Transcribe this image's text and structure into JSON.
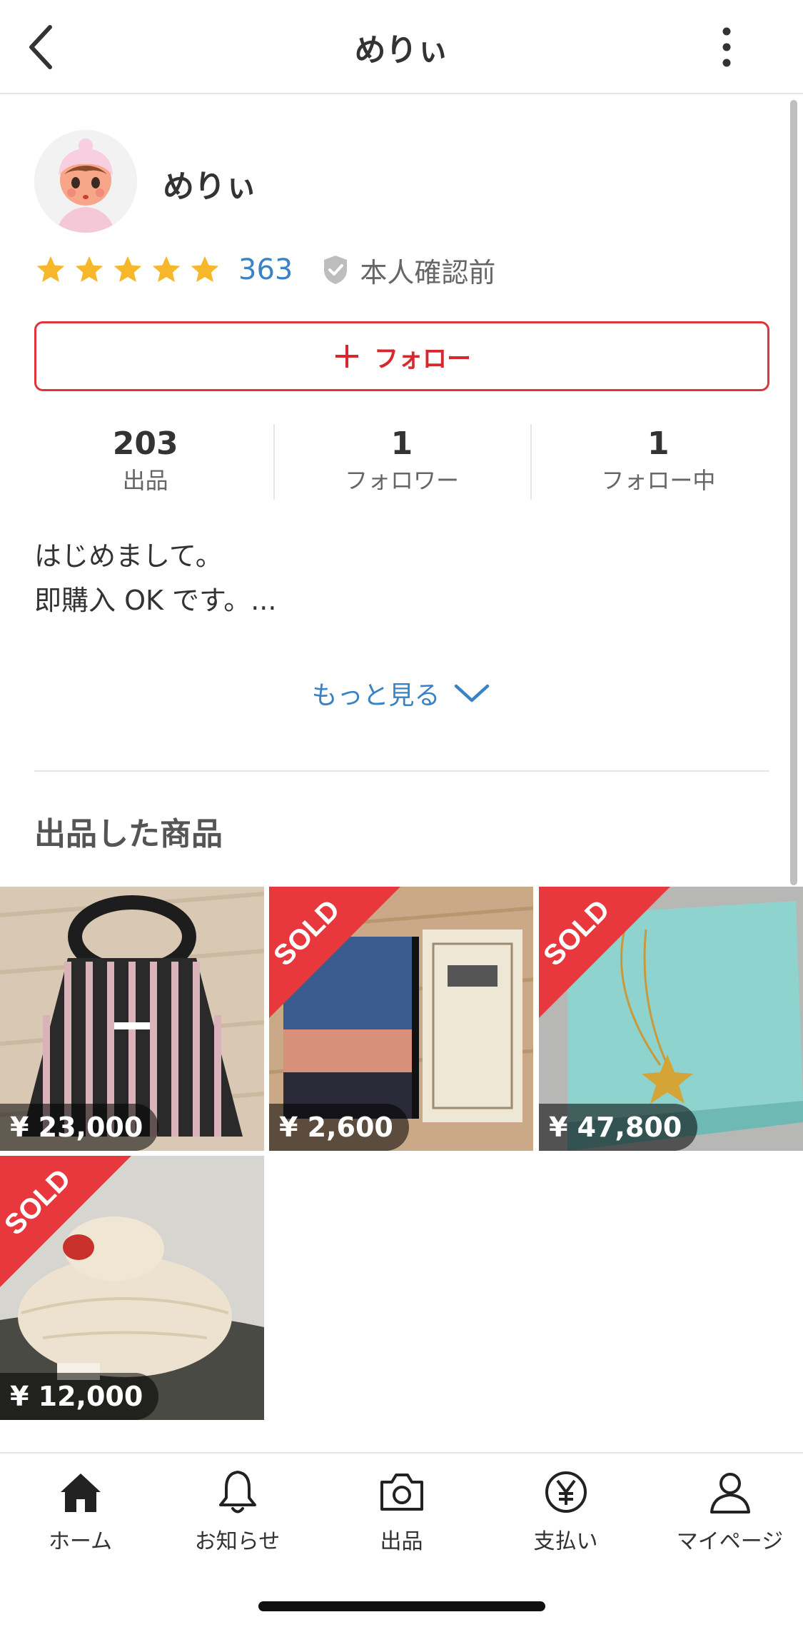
{
  "header": {
    "title": "めりぃ",
    "back_icon": "chevron-left-icon",
    "more_icon": "more-vertical-icon"
  },
  "profile": {
    "name": "めりぃ",
    "rating_stars": 5,
    "rating_count": "363",
    "verification": "本人確認前",
    "follow_label": "フォロー"
  },
  "stats": [
    {
      "value": "203",
      "label": "出品"
    },
    {
      "value": "1",
      "label": "フォロワー"
    },
    {
      "value": "1",
      "label": "フォロー中"
    }
  ],
  "bio": {
    "line1": "はじめまして。",
    "line2": "即購入 OK です。..."
  },
  "more_label": "もっと見る",
  "section_title": "出品した商品",
  "items": [
    {
      "price": "¥ 23,000",
      "sold": false
    },
    {
      "price": "¥ 2,600",
      "sold": true
    },
    {
      "price": "¥ 47,800",
      "sold": true
    },
    {
      "price": "¥ 12,000",
      "sold": true
    }
  ],
  "sold_label": "SOLD",
  "tabs": [
    {
      "label": "ホーム",
      "icon": "home-icon"
    },
    {
      "label": "お知らせ",
      "icon": "bell-icon"
    },
    {
      "label": "出品",
      "icon": "camera-icon"
    },
    {
      "label": "支払い",
      "icon": "yen-icon"
    },
    {
      "label": "マイページ",
      "icon": "person-icon"
    }
  ],
  "colors": {
    "accent": "#d7282f",
    "link": "#3b82c4",
    "star": "#f6b82a",
    "sold": "#e8383d"
  }
}
